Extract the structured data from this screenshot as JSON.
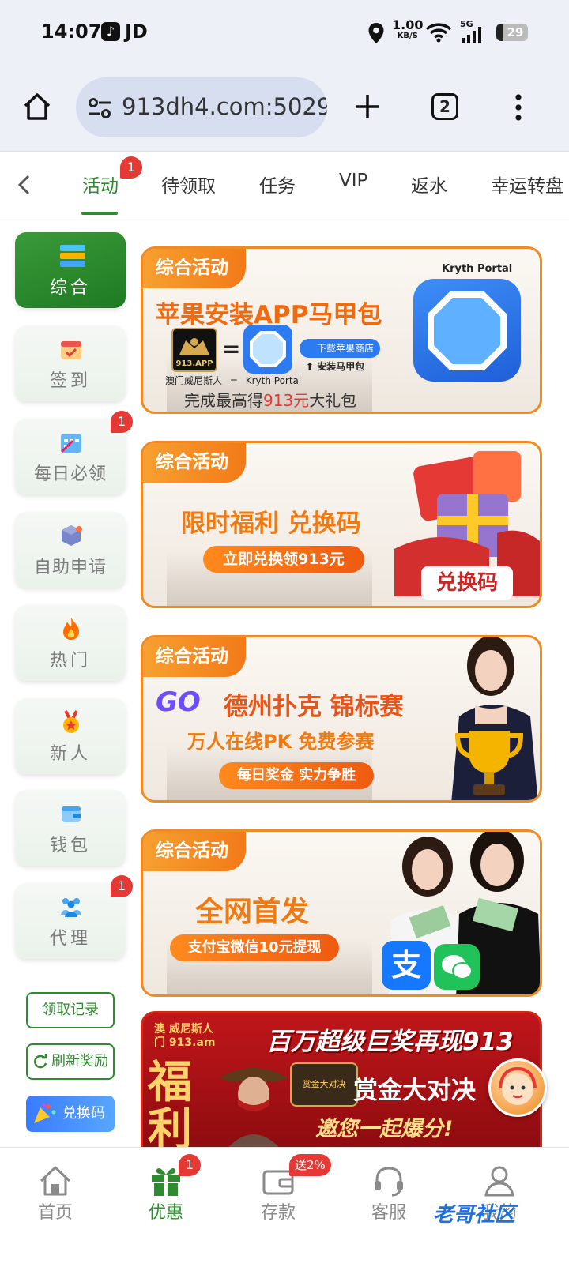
{
  "status_bar": {
    "time": "14:07",
    "carrier": "JD",
    "net_speed_value": "1.00",
    "net_speed_unit": "KB/S",
    "signal": "5G",
    "battery": "29"
  },
  "browser": {
    "url": "913dh4.com:5029",
    "tab_count": "2"
  },
  "category_tabs": [
    {
      "label": "活动",
      "active": true,
      "badge": "1"
    },
    {
      "label": "待领取"
    },
    {
      "label": "任务"
    },
    {
      "label": "VIP"
    },
    {
      "label": "返水"
    },
    {
      "label": "幸运转盘"
    }
  ],
  "sidebar": {
    "items": [
      {
        "label": "综合",
        "icon": "layers-icon",
        "active": true
      },
      {
        "label": "签到",
        "icon": "calendar-icon"
      },
      {
        "label": "每日必领",
        "icon": "daily-calendar-icon",
        "badge": "1"
      },
      {
        "label": "自助申请",
        "icon": "cube-icon"
      },
      {
        "label": "热门",
        "icon": "fire-icon"
      },
      {
        "label": "新人",
        "icon": "medal-icon"
      },
      {
        "label": "钱包",
        "icon": "wallet-icon"
      },
      {
        "label": "代理",
        "icon": "agents-icon",
        "badge": "1"
      }
    ],
    "buttons": {
      "record": "领取记录",
      "refresh": "刷新奖励",
      "redeem": "兑换码"
    }
  },
  "banners": [
    {
      "tag": "综合活动",
      "title": "苹果安装APP马甲包",
      "app_caption": "913.APP",
      "left_name": "澳门威尼斯人",
      "eq": "=",
      "right_name": "Kryth Portal",
      "store_button": "下载苹果商店",
      "install_note": "安装马甲包",
      "portal_label": "Kryth Portal",
      "footer_prefix": "完成最高得",
      "footer_amount": "913元",
      "footer_suffix": "大礼包"
    },
    {
      "tag": "综合活动",
      "title": "限时福利 兑换码",
      "pill": "立即兑换领913元",
      "box_label": "兑换码"
    },
    {
      "tag": "综合活动",
      "go": "GO",
      "title": "德州扑克 锦标赛",
      "subtitle": "万人在线PK 免费参赛",
      "pill": "每日奖金 实力争胜"
    },
    {
      "tag": "综合活动",
      "title": "全网首发",
      "pill": "支付宝微信10元提现",
      "alipay_char": "支"
    },
    {
      "brand_top": "澳 威尼斯人",
      "brand_bottom": "门 913.am",
      "headline": "百万超级巨奖再现913",
      "side_char_1": "福",
      "side_char_2": "利",
      "bounty_badge": "赏金大对决",
      "bounty": "赏金大对决",
      "invite": "邀您一起爆分!"
    }
  ],
  "bottom_nav": [
    {
      "label": "首页",
      "icon": "home-icon"
    },
    {
      "label": "优惠",
      "icon": "gift-icon",
      "active": true,
      "badge": "1"
    },
    {
      "label": "存款",
      "icon": "wallet-card-icon",
      "badge": "送2%"
    },
    {
      "label": "客服",
      "icon": "headset-icon"
    },
    {
      "label": "我的",
      "icon": "user-icon"
    }
  ],
  "watermark": "老哥社区",
  "colors": {
    "accent_green": "#2e8b2e",
    "banner_orange": "#f08a23",
    "badge_red": "#e53935"
  }
}
